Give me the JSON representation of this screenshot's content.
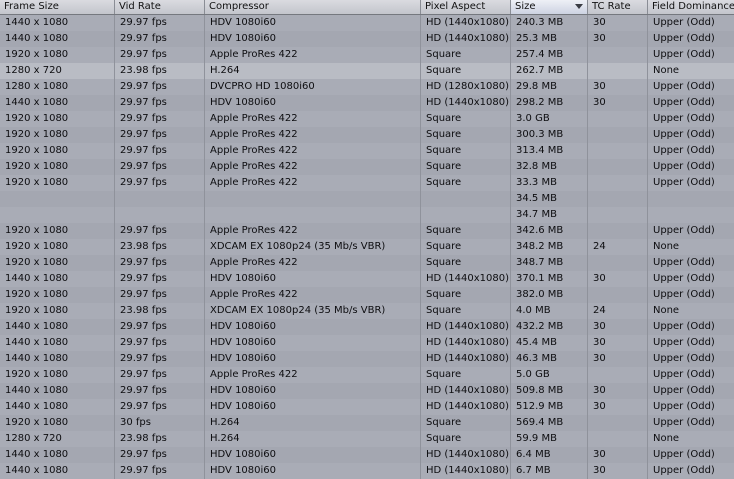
{
  "columns": [
    "Frame Size",
    "Vid Rate",
    "Compressor",
    "Pixel Aspect",
    "Size",
    "TC Rate",
    "Field Dominance"
  ],
  "rows": [
    [
      "1440 x 1080",
      "29.97 fps",
      "HDV 1080i60",
      "HD (1440x1080)",
      "240.3 MB",
      "30",
      "Upper (Odd)"
    ],
    [
      "1440 x 1080",
      "29.97 fps",
      "HDV 1080i60",
      "HD (1440x1080)",
      "25.3 MB",
      "30",
      "Upper (Odd)"
    ],
    [
      "1920 x 1080",
      "29.97 fps",
      "Apple ProRes 422",
      "Square",
      "257.4 MB",
      "",
      "Upper (Odd)"
    ],
    [
      "1280 x 720",
      "23.98 fps",
      "H.264",
      "Square",
      "262.7 MB",
      "",
      "None"
    ],
    [
      "1280 x 1080",
      "29.97 fps",
      "DVCPRO HD 1080i60",
      "HD (1280x1080)",
      "29.8 MB",
      "30",
      "Upper (Odd)"
    ],
    [
      "1440 x 1080",
      "29.97 fps",
      "HDV 1080i60",
      "HD (1440x1080)",
      "298.2 MB",
      "30",
      "Upper (Odd)"
    ],
    [
      "1920 x 1080",
      "29.97 fps",
      "Apple ProRes 422",
      "Square",
      "3.0 GB",
      "",
      "Upper (Odd)"
    ],
    [
      "1920 x 1080",
      "29.97 fps",
      "Apple ProRes 422",
      "Square",
      "300.3 MB",
      "",
      "Upper (Odd)"
    ],
    [
      "1920 x 1080",
      "29.97 fps",
      "Apple ProRes 422",
      "Square",
      "313.4 MB",
      "",
      "Upper (Odd)"
    ],
    [
      "1920 x 1080",
      "29.97 fps",
      "Apple ProRes 422",
      "Square",
      "32.8 MB",
      "",
      "Upper (Odd)"
    ],
    [
      "1920 x 1080",
      "29.97 fps",
      "Apple ProRes 422",
      "Square",
      "33.3 MB",
      "",
      "Upper (Odd)"
    ],
    [
      "",
      "",
      "",
      "",
      "34.5 MB",
      "",
      ""
    ],
    [
      "",
      "",
      "",
      "",
      "34.7 MB",
      "",
      ""
    ],
    [
      "1920 x 1080",
      "29.97 fps",
      "Apple ProRes 422",
      "Square",
      "342.6 MB",
      "",
      "Upper (Odd)"
    ],
    [
      "1920 x 1080",
      "23.98 fps",
      "XDCAM EX 1080p24 (35 Mb/s VBR)",
      "Square",
      "348.2 MB",
      "24",
      "None"
    ],
    [
      "1920 x 1080",
      "29.97 fps",
      "Apple ProRes 422",
      "Square",
      "348.7 MB",
      "",
      "Upper (Odd)"
    ],
    [
      "1440 x 1080",
      "29.97 fps",
      "HDV 1080i60",
      "HD (1440x1080)",
      "370.1 MB",
      "30",
      "Upper (Odd)"
    ],
    [
      "1920 x 1080",
      "29.97 fps",
      "Apple ProRes 422",
      "Square",
      "382.0 MB",
      "",
      "Upper (Odd)"
    ],
    [
      "1920 x 1080",
      "23.98 fps",
      "XDCAM EX 1080p24 (35 Mb/s VBR)",
      "Square",
      "4.0 MB",
      "24",
      "None"
    ],
    [
      "1440 x 1080",
      "29.97 fps",
      "HDV 1080i60",
      "HD (1440x1080)",
      "432.2 MB",
      "30",
      "Upper (Odd)"
    ],
    [
      "1440 x 1080",
      "29.97 fps",
      "HDV 1080i60",
      "HD (1440x1080)",
      "45.4 MB",
      "30",
      "Upper (Odd)"
    ],
    [
      "1440 x 1080",
      "29.97 fps",
      "HDV 1080i60",
      "HD (1440x1080)",
      "46.3 MB",
      "30",
      "Upper (Odd)"
    ],
    [
      "1920 x 1080",
      "29.97 fps",
      "Apple ProRes 422",
      "Square",
      "5.0 GB",
      "",
      "Upper (Odd)"
    ],
    [
      "1440 x 1080",
      "29.97 fps",
      "HDV 1080i60",
      "HD (1440x1080)",
      "509.8 MB",
      "30",
      "Upper (Odd)"
    ],
    [
      "1440 x 1080",
      "29.97 fps",
      "HDV 1080i60",
      "HD (1440x1080)",
      "512.9 MB",
      "30",
      "Upper (Odd)"
    ],
    [
      "1920 x 1080",
      "30 fps",
      "H.264",
      "Square",
      "569.4 MB",
      "",
      "Upper (Odd)"
    ],
    [
      "1280 x 720",
      "23.98 fps",
      "H.264",
      "Square",
      "59.9 MB",
      "",
      "None"
    ],
    [
      "1440 x 1080",
      "29.97 fps",
      "HDV 1080i60",
      "HD (1440x1080)",
      "6.4 MB",
      "30",
      "Upper (Odd)"
    ],
    [
      "1440 x 1080",
      "29.97 fps",
      "HDV 1080i60",
      "HD (1440x1080)",
      "6.7 MB",
      "30",
      "Upper (Odd)"
    ]
  ]
}
